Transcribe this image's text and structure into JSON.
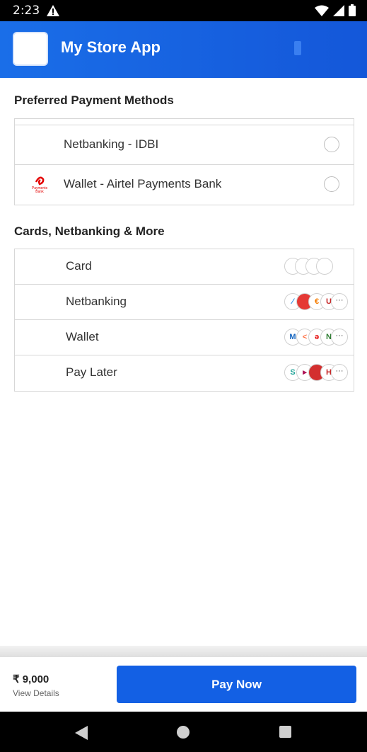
{
  "status_bar": {
    "time": "2:23"
  },
  "app": {
    "title": "My Store App"
  },
  "preferred": {
    "title": "Preferred Payment Methods",
    "items": [
      {
        "label": "Netbanking - IDBI",
        "icon": "bank-icon"
      },
      {
        "label": "Wallet - Airtel Payments Bank",
        "icon": "airtel-payments-bank-logo",
        "logo_text": "Payments Bank"
      }
    ]
  },
  "more_options": {
    "title": "Cards, Netbanking & More",
    "items": [
      {
        "label": "Card",
        "logos": []
      },
      {
        "label": "Netbanking",
        "logos": []
      },
      {
        "label": "Wallet",
        "logos": []
      },
      {
        "label": "Pay Later",
        "logos": []
      }
    ],
    "more_symbol": "···"
  },
  "footer": {
    "amount": "₹ 9,000",
    "view_details": "View Details",
    "pay_button": "Pay Now"
  },
  "colors": {
    "primary": "#1360e4",
    "appbar": "#1a6ee8"
  }
}
